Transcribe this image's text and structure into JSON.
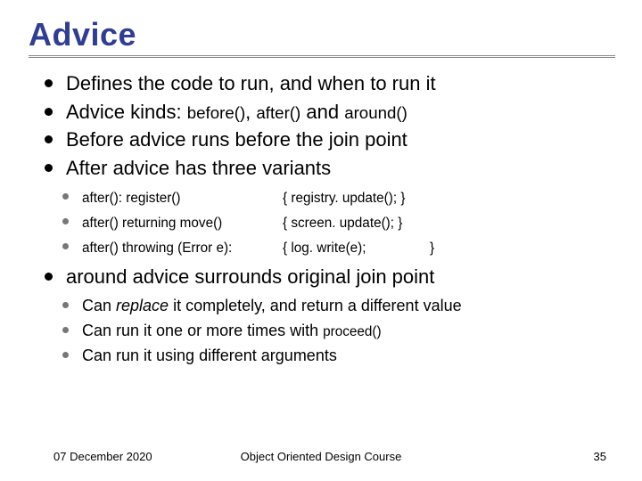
{
  "title": "Advice",
  "bullets": {
    "b1": "Defines the code to run, and when to run it",
    "b2_pre": "Advice kinds: ",
    "b2_kw1": "before()",
    "b2_sep1": ", ",
    "b2_kw2": "after()",
    "b2_mid": " and ",
    "b2_kw3": "around()",
    "b3": "Before advice runs before the join point",
    "b4": "After advice has three variants",
    "b5_pre": "around",
    "b5_rest": " advice surrounds original join point"
  },
  "sub1": {
    "r1a": "after(): register()",
    "r1b": "{ registry. update(); }",
    "r2a": "after() returning move()",
    "r2b": "{ screen. update();  }",
    "r3a": "after() throwing (Error e):",
    "r3b": "{ log. write(e);",
    "r3c": "}"
  },
  "sub2": {
    "s1_pre": "Can ",
    "s1_em": "replace",
    "s1_rest": " it completely, and return a different value",
    "s2_pre": "Can run it one or more times with ",
    "s2_kw": "proceed()",
    "s3": "Can run it using different arguments"
  },
  "footer": {
    "date": "07 December 2020",
    "course": "Object Oriented Design Course",
    "page": "35"
  }
}
